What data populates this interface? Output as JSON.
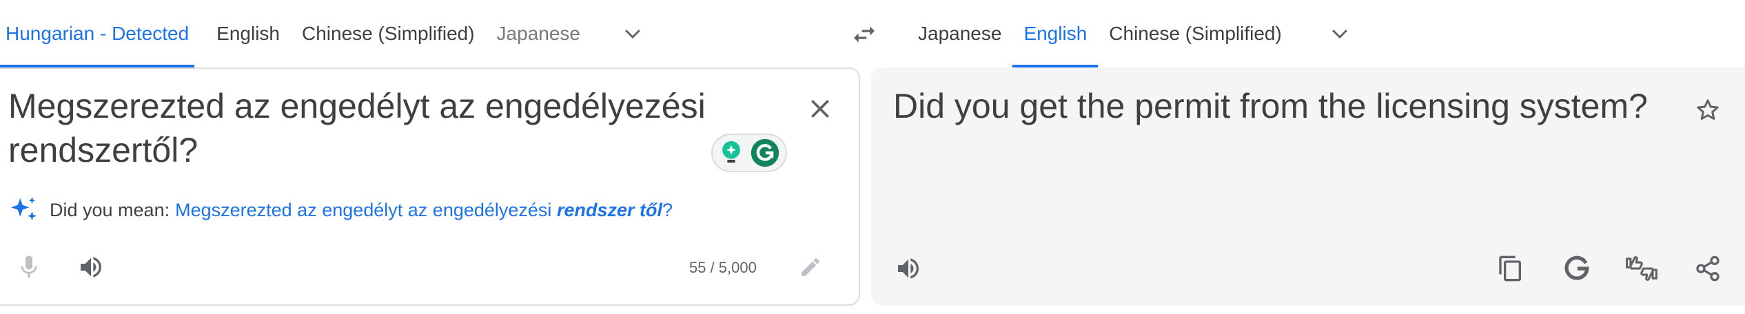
{
  "source_languages": [
    {
      "label": "Hungarian - Detected",
      "active": true
    },
    {
      "label": "English",
      "active": false
    },
    {
      "label": "Chinese (Simplified)",
      "active": false
    },
    {
      "label": "Japanese",
      "active": false
    }
  ],
  "target_languages": [
    {
      "label": "Japanese",
      "active": false
    },
    {
      "label": "English",
      "active": true
    },
    {
      "label": "Chinese (Simplified)",
      "active": false
    }
  ],
  "source": {
    "text": "Megszerezted az engedélyt az engedélyezési rendszertől?",
    "char_count": "55 / 5,000"
  },
  "suggestion": {
    "prefix": "Did you mean:",
    "correct_part": "Megszerezted az engedélyt az engedélyezési",
    "corrected_part": "rendszer től",
    "suffix": "?"
  },
  "target": {
    "text": "Did you get the permit from the licensing system?"
  },
  "icons": {
    "source_toolbar": [
      "microphone-icon",
      "speaker-icon",
      "pencil-icon"
    ],
    "target_toolbar": [
      "speaker-icon",
      "copy-icon",
      "google-g-icon",
      "feedback-icon",
      "share-icon",
      "star-icon"
    ],
    "swap": "swap-languages-icon",
    "clear": "close-icon",
    "extension": "grammarly-icon"
  },
  "colors": {
    "accent": "#1a73e8",
    "text": "#3c4043",
    "muted": "#5f6368",
    "target_bg": "#f5f5f5",
    "grammarly_green": "#15c39a"
  }
}
